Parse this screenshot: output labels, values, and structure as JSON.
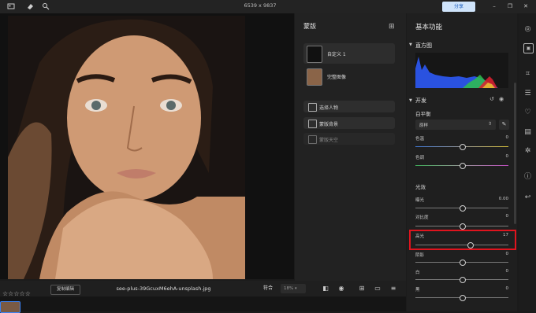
{
  "topbar": {
    "image_dimensions": "6539 x 9837",
    "share_label": "分享",
    "icons": [
      "photo-library-icon",
      "eraser-icon",
      "magic-wand-icon"
    ],
    "window_controls": [
      "minimize-icon",
      "maximize-icon",
      "close-icon"
    ]
  },
  "mask_panel": {
    "title": "蒙版",
    "masks": [
      {
        "label": "自定义 1",
        "selected": true
      },
      {
        "label": "完整图像",
        "selected": false
      }
    ],
    "actions": [
      {
        "label": "选择人物"
      },
      {
        "label": "蒙版背景"
      },
      {
        "label": "蒙版天空"
      }
    ]
  },
  "adjust_panel": {
    "title": "基本功能",
    "histogram_label": "直方图",
    "develop_label": "开发",
    "white_balance": {
      "label": "白平衡",
      "preset": "原样",
      "sliders": [
        {
          "label": "色温",
          "value": "0"
        },
        {
          "label": "色调",
          "value": "0"
        }
      ]
    },
    "light": {
      "label": "光效",
      "sliders": [
        {
          "label": "曝光",
          "value": "0.00"
        },
        {
          "label": "对比度",
          "value": "0"
        },
        {
          "label": "高光",
          "value": "17"
        },
        {
          "label": "阴影",
          "value": "0"
        },
        {
          "label": "白",
          "value": "0"
        },
        {
          "label": "黑",
          "value": "0"
        }
      ],
      "highlight_knob_fraction": 0.585
    },
    "highlight_color": "#e0141e",
    "accent_color": "#3b82f6"
  },
  "bottombar": {
    "rating_stars": 5,
    "copy_edit_label": "复制编辑",
    "filename": "see-plus-39GcuxM6ehA-unsplash.jpg",
    "fit_label": "符合",
    "zoom_value": "18%"
  },
  "rail_icons": [
    "layers-icon",
    "mask-icon",
    "crop-icon",
    "adjust-icon",
    "heal-icon",
    "presets-icon",
    "effects-icon",
    "info-icon",
    "history-icon"
  ]
}
